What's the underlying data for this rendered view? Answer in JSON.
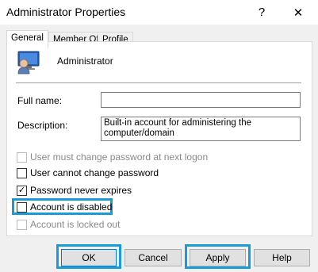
{
  "window": {
    "title": "Administrator Properties",
    "help_glyph": "?",
    "close_glyph": "✕"
  },
  "tabs": [
    {
      "label": "General",
      "active": true
    },
    {
      "label": "Member Of",
      "active": false
    },
    {
      "label": "Profile",
      "active": false
    }
  ],
  "user": {
    "name": "Administrator",
    "icon": "user-icon"
  },
  "fields": {
    "full_name_label": "Full name:",
    "full_name_value": "",
    "description_label": "Description:",
    "description_line1": "Built-in account for administering the",
    "description_line2": "computer/domain"
  },
  "checkboxes": [
    {
      "label": "User must change password at next logon",
      "checked": false,
      "enabled": false
    },
    {
      "label": "User cannot change password",
      "checked": false,
      "enabled": true
    },
    {
      "label": "Password never expires",
      "checked": true,
      "enabled": true
    },
    {
      "label": "Account is disabled",
      "checked": false,
      "enabled": true
    },
    {
      "label": "Account is locked out",
      "checked": false,
      "enabled": false
    }
  ],
  "check_glyph": "✓",
  "buttons": {
    "ok": "OK",
    "cancel": "Cancel",
    "apply": "Apply",
    "help": "Help"
  },
  "colors": {
    "highlight": "#1a9ad6",
    "dialog_bg": "#f0f0f0"
  }
}
